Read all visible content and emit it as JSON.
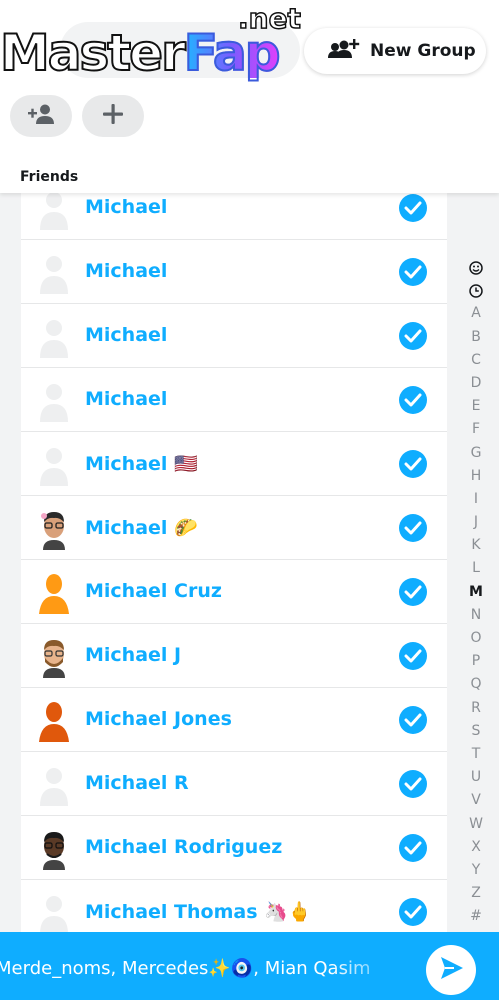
{
  "watermark": {
    "main": "Master",
    "accent": "Fap",
    "sup": ".net"
  },
  "header": {
    "new_group_label": "New Group",
    "friends_title": "Friends"
  },
  "colors": {
    "accent": "#0fadff",
    "background": "#f2f3f4",
    "text_dark": "#16191c"
  },
  "friends": [
    {
      "name": "Michael",
      "emoji": "",
      "avatar": "ghost",
      "selected": true
    },
    {
      "name": "Michael",
      "emoji": "",
      "avatar": "ghost",
      "selected": true
    },
    {
      "name": "Michael",
      "emoji": "",
      "avatar": "ghost",
      "selected": true
    },
    {
      "name": "Michael",
      "emoji": "",
      "avatar": "ghost",
      "selected": true
    },
    {
      "name": "Michael",
      "emoji": "🇺🇸",
      "avatar": "ghost",
      "selected": true
    },
    {
      "name": "Michael",
      "emoji": "🌮",
      "avatar": "bitmoji-glasses",
      "selected": true
    },
    {
      "name": "Michael Cruz",
      "emoji": "",
      "avatar": "silhouette-orange",
      "selected": true
    },
    {
      "name": "Michael J",
      "emoji": "",
      "avatar": "bitmoji-beard",
      "selected": true
    },
    {
      "name": "Michael Jones",
      "emoji": "",
      "avatar": "silhouette-rust",
      "selected": true
    },
    {
      "name": "Michael R",
      "emoji": "",
      "avatar": "ghost",
      "selected": true
    },
    {
      "name": "Michael Rodriguez",
      "emoji": "",
      "avatar": "bitmoji-dark",
      "selected": true
    },
    {
      "name": "Michael Thomas",
      "emoji": "🦄🖕",
      "avatar": "ghost",
      "selected": true
    }
  ],
  "alphabet_index": {
    "icons": [
      "smiley-icon",
      "clock-icon"
    ],
    "letters": [
      "A",
      "B",
      "C",
      "D",
      "E",
      "F",
      "G",
      "H",
      "I",
      "J",
      "K",
      "L",
      "M",
      "N",
      "O",
      "P",
      "Q",
      "R",
      "S",
      "T",
      "U",
      "V",
      "W",
      "X",
      "Y",
      "Z",
      "#"
    ],
    "active": "M"
  },
  "send_bar": {
    "recipients_text": "Merde_noms, Mercedes✨🧿, Mian Qasim"
  }
}
